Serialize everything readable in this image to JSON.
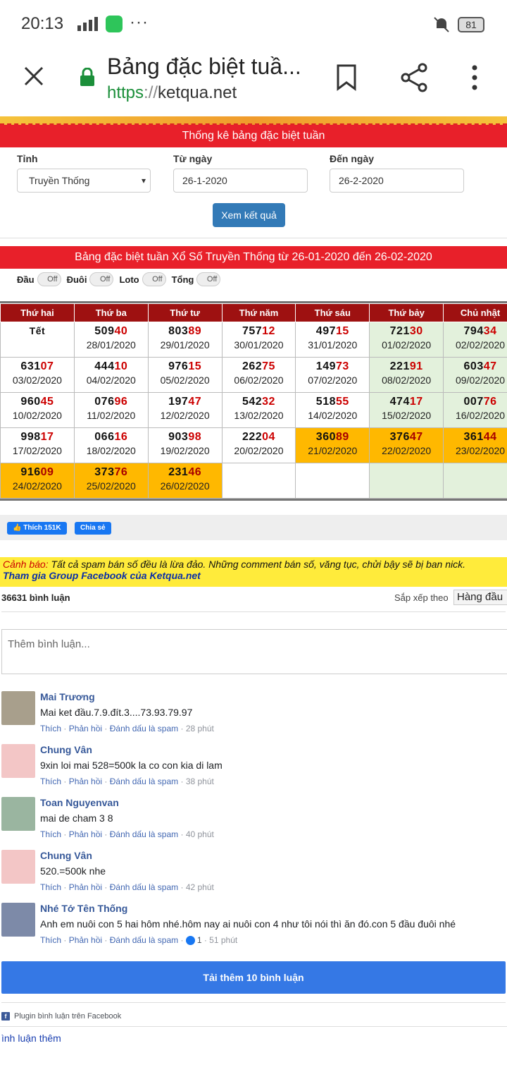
{
  "status": {
    "time": "20:13",
    "network": "4G",
    "battery": "81"
  },
  "browser": {
    "title": "Bảng đặc biệt tuầ...",
    "url_scheme": "https",
    "url_sep": "://",
    "url_host": "ketqua.net"
  },
  "section1": {
    "title": "Thống kê bảng đặc biệt tuần"
  },
  "form": {
    "province_label": "Tỉnh",
    "province_value": "Truyền Thống",
    "from_label": "Từ ngày",
    "from_value": "26-1-2020",
    "to_label": "Đến ngày",
    "to_value": "26-2-2020",
    "submit_label": "Xem kết quả"
  },
  "section2": {
    "title": "Bảng đặc biệt tuần Xổ Số Truyền Thống từ 26-01-2020 đến 26-02-2020"
  },
  "toggles": [
    {
      "label": "Đầu",
      "state": "Off"
    },
    {
      "label": "Đuôi",
      "state": "Off"
    },
    {
      "label": "Loto",
      "state": "Off"
    },
    {
      "label": "Tổng",
      "state": "Off"
    }
  ],
  "table": {
    "headers": [
      "Thứ hai",
      "Thứ ba",
      "Thứ tư",
      "Thứ năm",
      "Thứ sáu",
      "Thứ bảy",
      "Chủ nhật"
    ],
    "rows": [
      [
        {
          "head": "Tết",
          "tail": "",
          "date": ""
        },
        {
          "head": "509",
          "tail": "40",
          "date": "28/01/2020"
        },
        {
          "head": "803",
          "tail": "89",
          "date": "29/01/2020"
        },
        {
          "head": "757",
          "tail": "12",
          "date": "30/01/2020"
        },
        {
          "head": "497",
          "tail": "15",
          "date": "31/01/2020"
        },
        {
          "head": "721",
          "tail": "30",
          "date": "01/02/2020"
        },
        {
          "head": "794",
          "tail": "34",
          "date": "02/02/2020"
        }
      ],
      [
        {
          "head": "631",
          "tail": "07",
          "date": "03/02/2020"
        },
        {
          "head": "444",
          "tail": "10",
          "date": "04/02/2020"
        },
        {
          "head": "976",
          "tail": "15",
          "date": "05/02/2020"
        },
        {
          "head": "262",
          "tail": "75",
          "date": "06/02/2020"
        },
        {
          "head": "149",
          "tail": "73",
          "date": "07/02/2020"
        },
        {
          "head": "221",
          "tail": "91",
          "date": "08/02/2020"
        },
        {
          "head": "603",
          "tail": "47",
          "date": "09/02/2020"
        }
      ],
      [
        {
          "head": "960",
          "tail": "45",
          "date": "10/02/2020"
        },
        {
          "head": "076",
          "tail": "96",
          "date": "11/02/2020"
        },
        {
          "head": "197",
          "tail": "47",
          "date": "12/02/2020"
        },
        {
          "head": "542",
          "tail": "32",
          "date": "13/02/2020"
        },
        {
          "head": "518",
          "tail": "55",
          "date": "14/02/2020"
        },
        {
          "head": "474",
          "tail": "17",
          "date": "15/02/2020"
        },
        {
          "head": "007",
          "tail": "76",
          "date": "16/02/2020"
        }
      ],
      [
        {
          "head": "998",
          "tail": "17",
          "date": "17/02/2020"
        },
        {
          "head": "066",
          "tail": "16",
          "date": "18/02/2020"
        },
        {
          "head": "903",
          "tail": "98",
          "date": "19/02/2020"
        },
        {
          "head": "222",
          "tail": "04",
          "date": "20/02/2020"
        },
        {
          "head": "360",
          "tail": "89",
          "date": "21/02/2020"
        },
        {
          "head": "376",
          "tail": "47",
          "date": "22/02/2020"
        },
        {
          "head": "361",
          "tail": "44",
          "date": "23/02/2020"
        }
      ],
      [
        {
          "head": "916",
          "tail": "09",
          "date": "24/02/2020"
        },
        {
          "head": "373",
          "tail": "76",
          "date": "25/02/2020"
        },
        {
          "head": "231",
          "tail": "46",
          "date": "26/02/2020"
        },
        {
          "head": "",
          "tail": "",
          "date": ""
        },
        {
          "head": "",
          "tail": "",
          "date": ""
        },
        {
          "head": "",
          "tail": "",
          "date": ""
        },
        {
          "head": "",
          "tail": "",
          "date": ""
        }
      ]
    ],
    "highlight_colors": {
      "weekend": "#e3f1dc",
      "orange": "#ffb800"
    }
  },
  "facebook": {
    "like_label": "Thích 151K",
    "share_label": "Chia sẻ"
  },
  "warning": {
    "prefix": "Cảnh báo:",
    "text": " Tất cả spam bán số đều là lừa đảo. Những comment bán số, văng tục, chửi bậy sẽ bị ban nick.",
    "group_link": "Tham gia Group Facebook của Ketqua.net"
  },
  "comments_header": {
    "count": "36631 bình luận",
    "sort_label": "Sắp xếp theo",
    "sort_value": "Hàng đầu"
  },
  "comment_input": {
    "placeholder": "Thêm bình luận..."
  },
  "comments": [
    {
      "name": "Mai Trương",
      "text": "Mai ket đầu.7.9.đít.3....73.93.79.97",
      "time": "28 phút",
      "likes": ""
    },
    {
      "name": "Chung Vân",
      "text": "9xin loi mai 528=500k la co con kia di lam",
      "time": "38 phút",
      "likes": ""
    },
    {
      "name": "Toan Nguyenvan",
      "text": "mai de cham 3 8",
      "time": "40 phút",
      "likes": ""
    },
    {
      "name": "Chung Vân",
      "text": "520.=500k nhe",
      "time": "42 phút",
      "likes": ""
    },
    {
      "name": "Nhé Tớ Tên Thống",
      "text": "Anh em nuôi con 5 hai hôm nhé.hôm nay ai nuôi con 4 như tôi nói thì ăn đó.con 5 đầu đuôi nhé",
      "time": "51 phút",
      "likes": "1"
    }
  ],
  "comment_actions": {
    "like": "Thích",
    "reply": "Phản hồi",
    "spam": "Đánh dấu là spam"
  },
  "load_more": "Tải thêm 10 bình luận",
  "plugin_label": "Plugin bình luận trên Facebook",
  "more_link": "ình luận thêm"
}
